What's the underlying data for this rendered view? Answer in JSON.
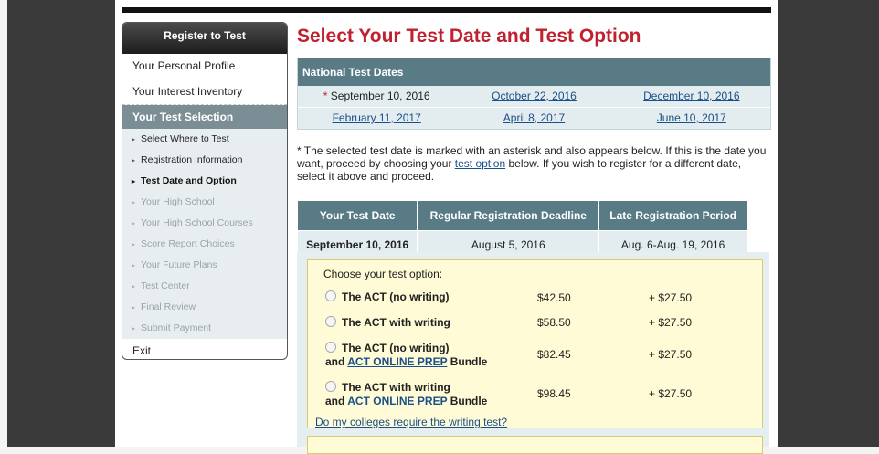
{
  "menu": {
    "header": "Register to Test",
    "items": [
      "Your Personal Profile",
      "Your Interest Inventory"
    ],
    "selected": "Your Test Selection",
    "sub_items": [
      "Select Where to Test",
      "Registration Information",
      "Test Date and Option",
      "Your High School",
      "Your High School Courses",
      "Score Report Choices",
      "Your Future Plans",
      "Test Center",
      "Final Review",
      "Submit Payment"
    ],
    "exit": "Exit"
  },
  "main": {
    "title": "Select Your Test Date and Test Option",
    "dates_header": "National Test Dates",
    "dates": [
      [
        "September 10, 2016",
        "October 22, 2016",
        "December 10, 2016"
      ],
      [
        "February 11, 2017",
        "April 8, 2017",
        "June 10, 2017"
      ]
    ],
    "note_part1": "* The selected test date is marked with an asterisk and also appears below. If this is the date you want, proceed by choosing your ",
    "note_link": "test option",
    "note_part2": " below. If you wish to register for a different date, select it above and proceed.",
    "table_headers": [
      "Your Test Date",
      "Regular Registration Deadline",
      "Late Registration Period"
    ],
    "table_row": [
      "September 10, 2016",
      "August 5, 2016",
      "Aug. 6-Aug. 19, 2016"
    ],
    "choose_label": "Choose your test option:",
    "options": [
      {
        "name": "The ACT (no writing)",
        "price": "$42.50",
        "late": "+ $27.50"
      },
      {
        "name": "The ACT with writing",
        "price": "$58.50",
        "late": "+ $27.50"
      },
      {
        "name": "The ACT (no writing)",
        "and": "and ",
        "link": "ACT ONLINE PREP",
        "suffix": " Bundle",
        "price": "$82.45",
        "late": "+ $27.50"
      },
      {
        "name": "The ACT with writing",
        "and": "and ",
        "link": "ACT ONLINE PREP",
        "suffix": " Bundle",
        "price": "$98.45",
        "late": "+ $27.50"
      }
    ],
    "colleges_link": "Do my colleges require the writing test?"
  },
  "colors": {
    "title": "#c0202f",
    "header": "#587b86",
    "link": "#1a4f8a",
    "option_bg": "#fffbd6"
  }
}
